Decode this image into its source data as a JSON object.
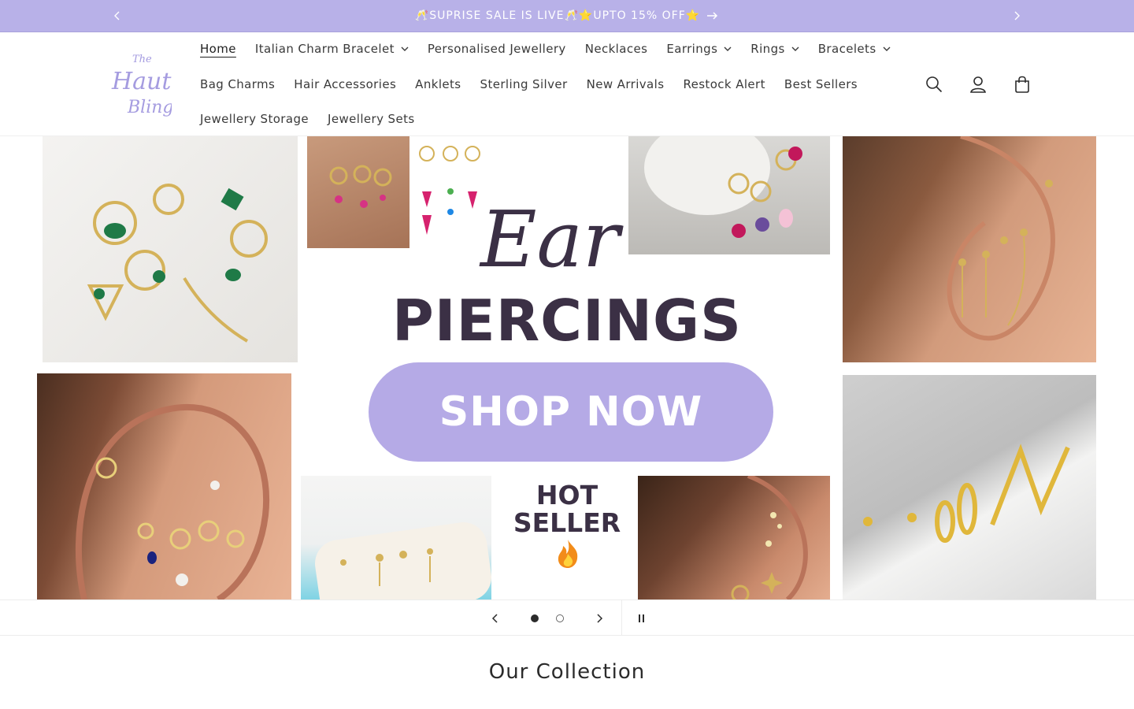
{
  "announcement": {
    "message": "🥂SUPRISE SALE IS LIVE🥂⭐UPTO 15% OFF⭐"
  },
  "brand": {
    "logo_line1": "The",
    "logo_line2": "Haute",
    "logo_line3": "Bling",
    "logo_color": "#a59ce0"
  },
  "nav": {
    "row1": [
      {
        "label": "Home",
        "active": true
      },
      {
        "label": "Italian Charm Bracelet",
        "dropdown": true
      },
      {
        "label": "Personalised Jewellery"
      },
      {
        "label": "Necklaces"
      },
      {
        "label": "Earrings",
        "dropdown": true
      },
      {
        "label": "Rings",
        "dropdown": true
      },
      {
        "label": "Bracelets",
        "dropdown": true
      }
    ],
    "row2": [
      {
        "label": "Bag Charms"
      },
      {
        "label": "Hair Accessories"
      },
      {
        "label": "Anklets"
      },
      {
        "label": "Sterling Silver"
      },
      {
        "label": "New Arrivals"
      },
      {
        "label": "Restock Alert"
      },
      {
        "label": "Best Sellers"
      }
    ],
    "row3": [
      {
        "label": "Jewellery Storage"
      },
      {
        "label": "Jewellery Sets"
      }
    ]
  },
  "hero": {
    "script_text": "Ear",
    "headline": "PIERCINGS",
    "cta": "SHOP NOW",
    "badge_line1": "HOT",
    "badge_line2": "SELLER",
    "accent": "#b5aae6",
    "headline_color": "#3b3045"
  },
  "slider": {
    "slide_count": 2,
    "current_slide": 1
  },
  "section": {
    "title": "Our Collection"
  }
}
